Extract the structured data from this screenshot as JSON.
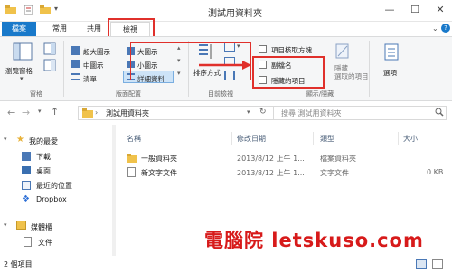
{
  "window": {
    "title": "測試用資料夾",
    "minimize": "—",
    "maximize": "☐",
    "close": "✕"
  },
  "tabs": [
    {
      "label": "檔案"
    },
    {
      "label": "常用"
    },
    {
      "label": "共用"
    },
    {
      "label": "檢視"
    }
  ],
  "ribbon": {
    "panes": {
      "nav_pane_label": "瀏覽窗格",
      "group_label": "窗格"
    },
    "layout": {
      "xl_icons": "超大圖示",
      "large_icons": "大圖示",
      "medium_icons": "中圖示",
      "small_icons": "小圖示",
      "list": "清單",
      "details": "詳細資料",
      "group_label": "版面配置"
    },
    "current_view": {
      "sort_by": "排序方式",
      "group_label": "目前檢視"
    },
    "show_hide": {
      "item_checkboxes": "項目核取方塊",
      "file_extensions": "副檔名",
      "hidden_items": "隱藏的項目",
      "hide_selected": "隱藏\n選取的項目",
      "group_label": "顯示/隱藏"
    },
    "options": {
      "label": "選項"
    }
  },
  "address": {
    "path": "測試用資料夾",
    "search_placeholder": "搜尋 測試用資料夾"
  },
  "nav": {
    "favorites": "我的最愛",
    "items": [
      {
        "label": "下載"
      },
      {
        "label": "桌面"
      },
      {
        "label": "最近的位置"
      },
      {
        "label": "Dropbox"
      }
    ],
    "libraries": "媒體櫃",
    "lib_items": [
      {
        "label": "文件"
      }
    ]
  },
  "columns": {
    "name": "名稱",
    "date": "修改日期",
    "type": "類型",
    "size": "大小"
  },
  "rows": [
    {
      "name": "一般資料夾",
      "date": "2013/8/12 上午 1...",
      "type": "檔案資料夾",
      "size": ""
    },
    {
      "name": "新文字文件",
      "date": "2013/8/12 上午 1...",
      "type": "文字文件",
      "size": "0 KB"
    }
  ],
  "status": {
    "count": "2 個項目"
  },
  "watermark": {
    "text": "電腦院 letskuso.com"
  },
  "colors": {
    "file_tab": "#1979ca",
    "highlight_red": "#e0302b",
    "folder_yellow": "#f0c24b",
    "watermark_red": "#d71a1a"
  }
}
